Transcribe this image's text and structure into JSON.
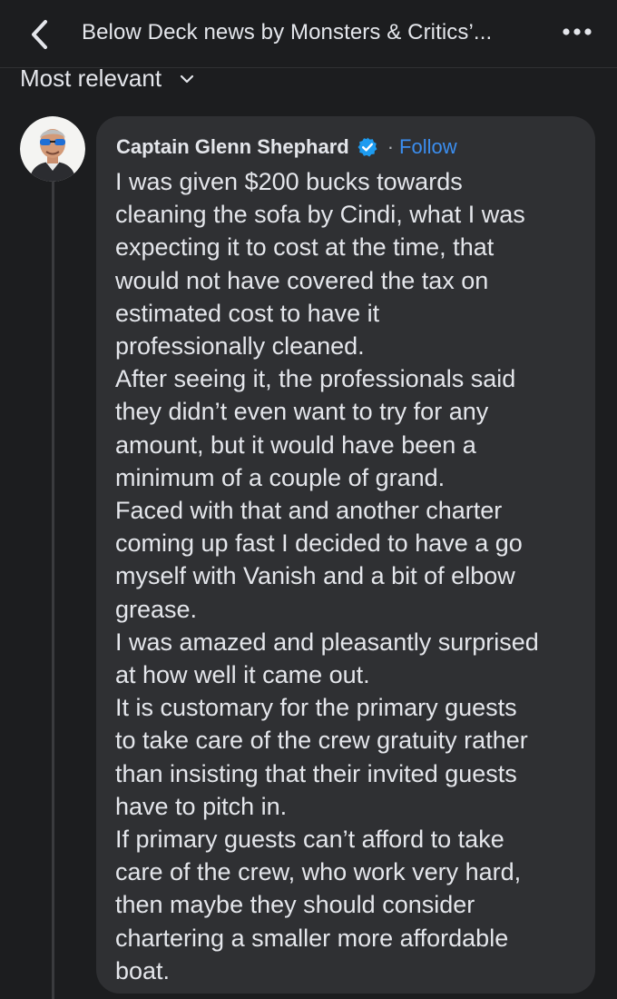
{
  "header": {
    "back_icon": "chevron-left-icon",
    "title": "Below Deck news by Monsters & Critics’...",
    "more_icon": "more-horizontal-icon"
  },
  "sort": {
    "label": "Most relevant",
    "icon": "chevron-down-icon"
  },
  "comment": {
    "author": "Captain Glenn Shephard",
    "verified_icon": "verified-badge-icon",
    "separator": "·",
    "follow_label": "Follow",
    "lines": [
      "I was given $200 bucks towards",
      "cleaning the sofa by Cindi, what I was",
      "expecting it to cost at the time, that",
      "would not have covered the tax on",
      "estimated cost to have it",
      "professionally cleaned.",
      "After seeing it, the professionals said",
      "they didn’t even want to try for any",
      "amount, but it would have been a",
      "minimum of a couple of grand.",
      "Faced with that and another charter",
      "coming up fast I decided to have a go",
      "myself with Vanish and a bit of elbow",
      "grease.",
      "I was amazed and pleasantly surprised",
      "at how well it came out.",
      "It is customary for the primary guests",
      "to take care of the crew gratuity rather",
      "than insisting that their invited guests",
      "have to pitch in.",
      "If primary guests can’t afford to take",
      "care of the crew, who work very hard,",
      "then maybe they should consider",
      "chartering a smaller more affordable",
      "boat."
    ]
  },
  "colors": {
    "background": "#1c1d1f",
    "bubble": "#2f3033",
    "text": "#e4e6eb",
    "link": "#3b8ef0",
    "verified": "#1d9bf0"
  }
}
